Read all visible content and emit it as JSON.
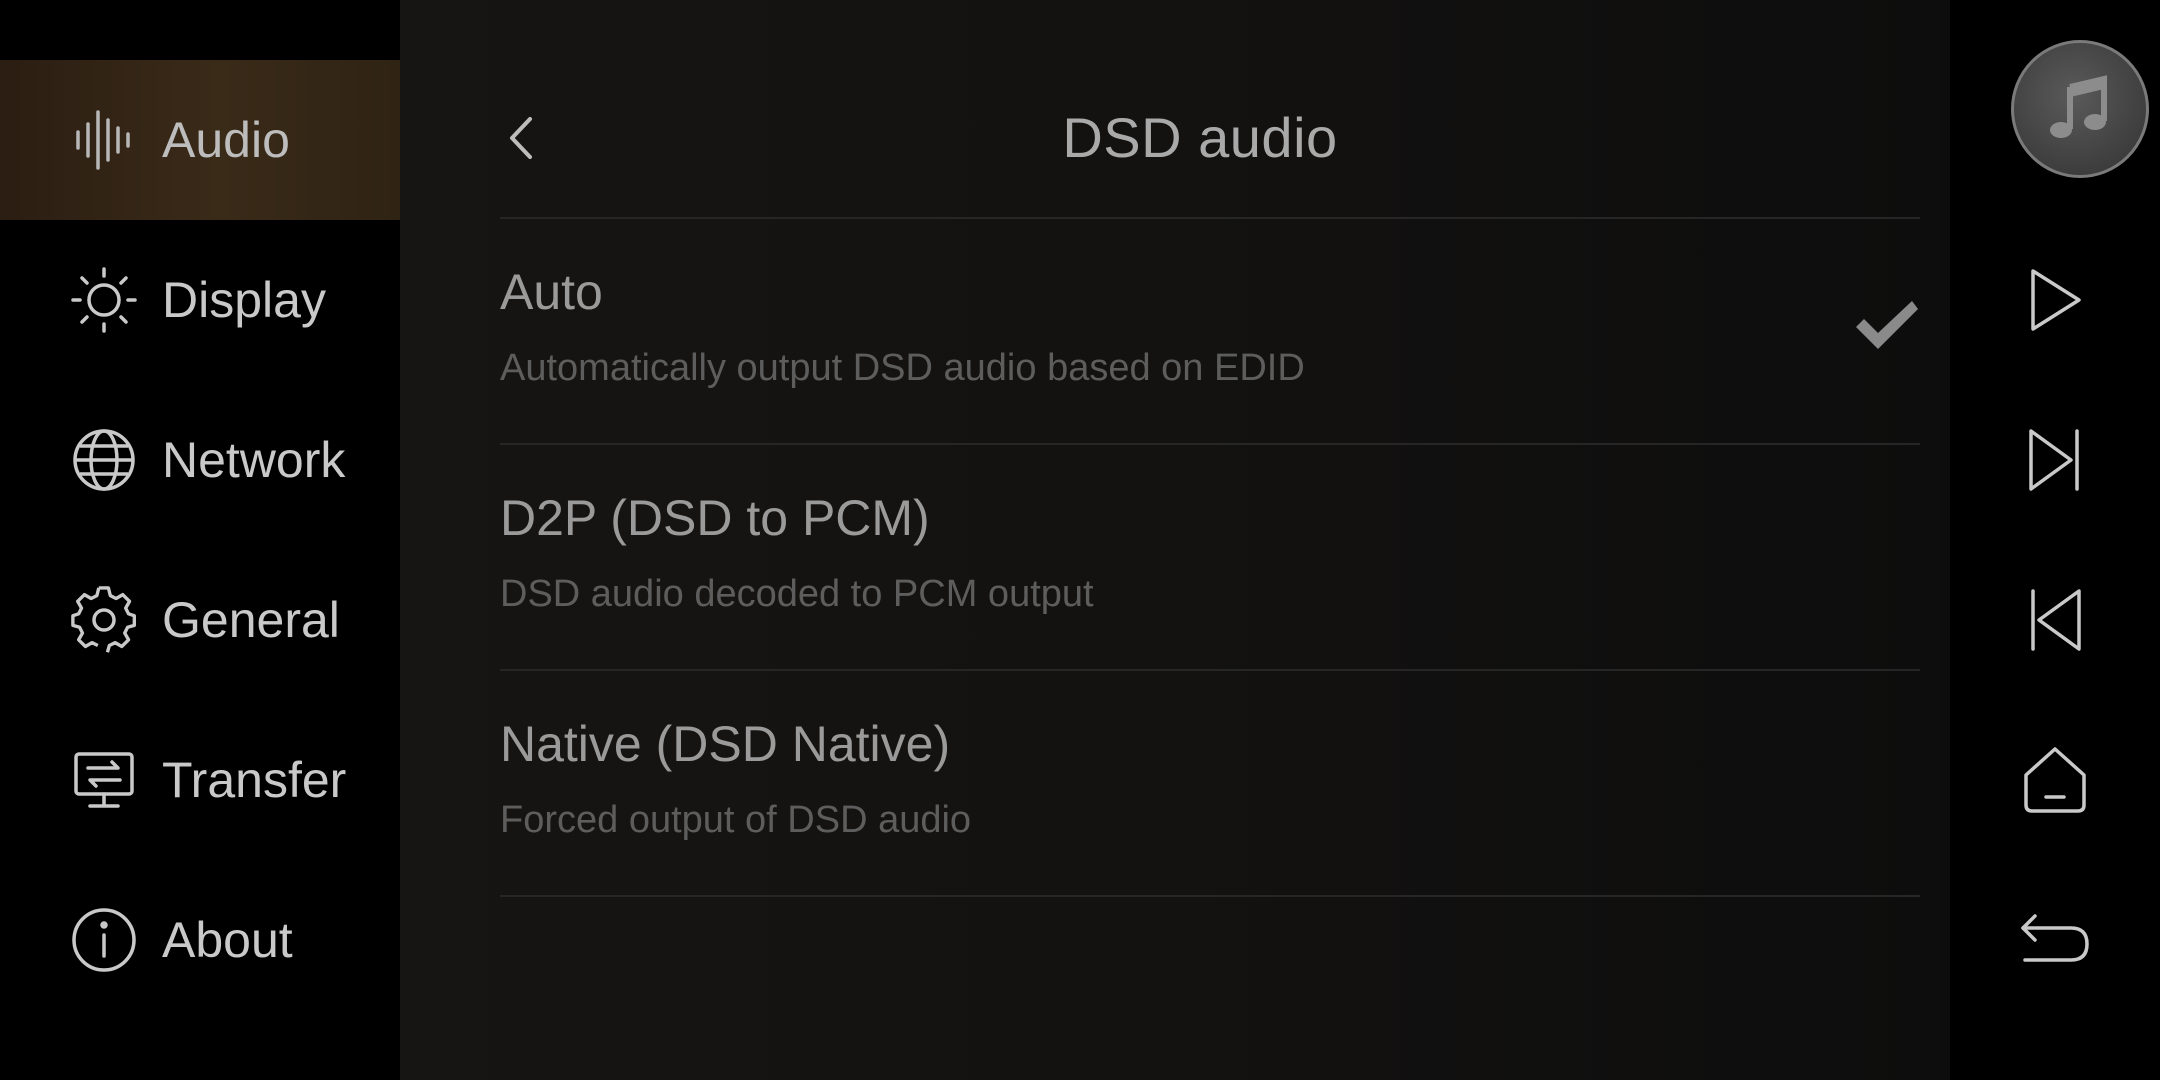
{
  "sidebar": {
    "items": [
      {
        "label": "Audio",
        "icon": "waveform-icon",
        "active": true
      },
      {
        "label": "Display",
        "icon": "sun-icon",
        "active": false
      },
      {
        "label": "Network",
        "icon": "globe-icon",
        "active": false
      },
      {
        "label": "General",
        "icon": "gear-icon",
        "active": false
      },
      {
        "label": "Transfer",
        "icon": "transfer-icon",
        "active": false
      },
      {
        "label": "About",
        "icon": "info-icon",
        "active": false
      }
    ]
  },
  "header": {
    "title": "DSD audio",
    "back_icon": "chevron-left-icon"
  },
  "options": [
    {
      "title": "Auto",
      "description": "Automatically output DSD audio based on EDID",
      "selected": true
    },
    {
      "title": "D2P (DSD to PCM)",
      "description": "DSD audio decoded to PCM output",
      "selected": false
    },
    {
      "title": "Native (DSD Native)",
      "description": "Forced output of DSD audio",
      "selected": false
    }
  ],
  "rail": {
    "buttons": [
      "music-note-icon",
      "play-icon",
      "skip-next-icon",
      "skip-previous-icon",
      "home-icon",
      "back-arrow-icon"
    ]
  },
  "colors": {
    "active_accent": "#3a2a18",
    "text_primary": "#c9c9c9",
    "text_secondary": "#5d5d5d",
    "background": "#000000"
  }
}
